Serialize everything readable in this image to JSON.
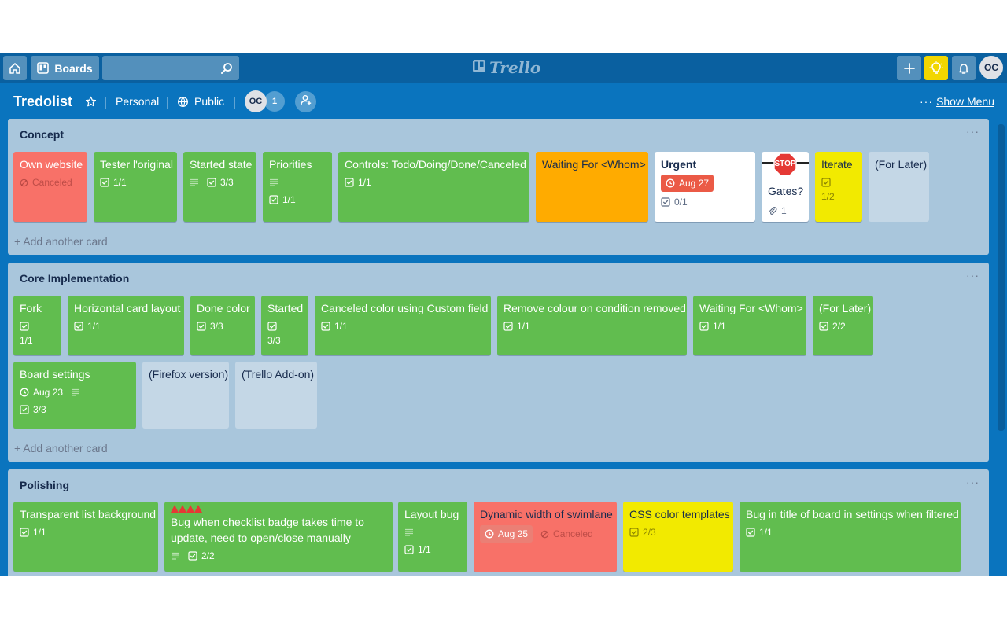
{
  "topbar": {
    "boards_label": "Boards",
    "search_value": "",
    "logo_text": "Trello",
    "user_initials": "OC"
  },
  "board": {
    "title": "Tredolist",
    "team": "Personal",
    "visibility": "Public",
    "member_initials": "OC",
    "member_count": "1",
    "menu_dots": "···",
    "show_menu_label": "Show Menu"
  },
  "add_card_label": "+ Add another card",
  "lanes": {
    "concept": {
      "title": "Concept",
      "cards": {
        "own_website": {
          "title": "Own website",
          "status": "Canceled"
        },
        "tester": {
          "title": "Tester l'original",
          "checklist": "1/1"
        },
        "started_state": {
          "title": "Started state",
          "checklist": "3/3"
        },
        "priorities": {
          "title": "Priorities",
          "checklist": "1/1"
        },
        "controls": {
          "title": "Controls: Todo/Doing/Done/Canceled",
          "checklist": "1/1"
        },
        "waiting": {
          "title": "Waiting For <Whom>"
        },
        "urgent": {
          "title": "Urgent",
          "due": "Aug 27",
          "checklist": "0/1"
        },
        "gates": {
          "sticker": "STOP",
          "title": "Gates?",
          "attachments": "1"
        },
        "iterate": {
          "title": "Iterate",
          "checklist": "1/2"
        },
        "for_later": {
          "title": "(For Later)"
        }
      }
    },
    "core": {
      "title": "Core Implementation",
      "cards": {
        "fork": {
          "title": "Fork",
          "checklist": "1/1"
        },
        "horizontal": {
          "title": "Horizontal card layout",
          "checklist": "1/1"
        },
        "done_color": {
          "title": "Done color",
          "checklist": "3/3"
        },
        "started": {
          "title": "Started",
          "checklist": "3/3"
        },
        "canceled_color": {
          "title": "Canceled color using Custom field",
          "checklist": "1/1"
        },
        "remove_colour": {
          "title": "Remove colour on condition removed",
          "checklist": "1/1"
        },
        "waiting": {
          "title": "Waiting For <Whom>",
          "checklist": "1/1"
        },
        "for_later": {
          "title": "(For Later)",
          "checklist": "2/2"
        },
        "board_settings": {
          "title": "Board settings",
          "due": "Aug 23",
          "checklist": "3/3"
        },
        "firefox": {
          "title": "(Firefox version)"
        },
        "addon": {
          "title": "(Trello Add-on)"
        }
      }
    },
    "polishing": {
      "title": "Polishing",
      "cards": {
        "transparent": {
          "title": "Transparent list background",
          "checklist": "1/1"
        },
        "bug_checklist": {
          "title": "Bug when checklist badge takes time to update, need to open/close manually",
          "checklist": "2/2"
        },
        "layout_bug": {
          "title": "Layout bug",
          "checklist": "1/1"
        },
        "dynamic_width": {
          "title": "Dynamic width of swimlane",
          "due": "Aug 25",
          "status": "Canceled"
        },
        "css_color": {
          "title": "CSS color templates",
          "checklist": "2/3"
        },
        "bug_title": {
          "title": "Bug in title of board in settings when filtered",
          "checklist": "1/1"
        }
      }
    }
  },
  "colors": {
    "board_bg": "#0a74be",
    "lane_bg": "#a9c6dc",
    "green": "#61bd4f",
    "red": "#f87168",
    "orange": "#ffab00",
    "yellow": "#f2ea00",
    "due_red": "#eb5a46"
  }
}
